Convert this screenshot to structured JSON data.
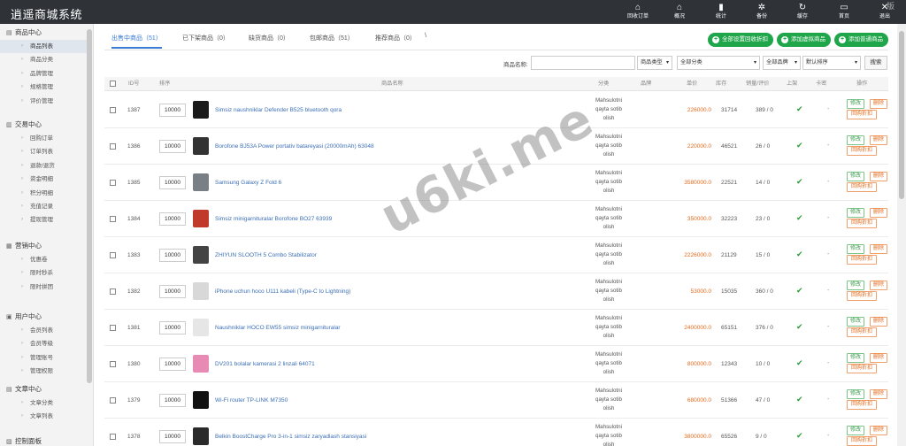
{
  "app": {
    "title": "逍遥商城系统",
    "corner_text": "版"
  },
  "topnav": [
    {
      "icon": "home-icon",
      "glyph": "⌂",
      "label": "回收订单"
    },
    {
      "icon": "home-icon",
      "glyph": "⌂",
      "label": "概况"
    },
    {
      "icon": "bar-chart-icon",
      "glyph": "▮",
      "label": "统计"
    },
    {
      "icon": "gear-icon",
      "glyph": "✲",
      "label": "备份"
    },
    {
      "icon": "refresh-icon",
      "glyph": "↻",
      "label": "缓存"
    },
    {
      "icon": "monitor-icon",
      "glyph": "▭",
      "label": "首页"
    },
    {
      "icon": "close-icon",
      "glyph": "✕",
      "label": "退出"
    }
  ],
  "sidebar": {
    "groups": [
      {
        "title": "商品中心",
        "icon": "box-icon",
        "items": [
          "商品列表",
          "商品分类",
          "品牌管理",
          "规格管理",
          "评价管理"
        ]
      },
      {
        "title": "交易中心",
        "icon": "chart-icon",
        "items": [
          "回购订单",
          "订单列表",
          "退款/退货",
          "资金明细",
          "积分明细",
          "充值记录",
          "提现管理"
        ]
      },
      {
        "title": "营销中心",
        "icon": "folder-icon",
        "items": [
          "优惠卷",
          "限时秒杀",
          "限时拼团"
        ]
      },
      {
        "title": "用户中心",
        "icon": "user-icon",
        "items": [
          "会员列表",
          "会员等级",
          "管理账号",
          "管理权限"
        ]
      },
      {
        "title": "文章中心",
        "icon": "doc-icon",
        "items": [
          "文章分类",
          "文章列表"
        ]
      },
      {
        "title": "控制面板",
        "icon": "settings-icon",
        "items": []
      }
    ],
    "active_item": "商品列表"
  },
  "tabs": [
    {
      "label": "出售中商品（51）",
      "active": true
    },
    {
      "label": "已下架商品（0）",
      "active": false
    },
    {
      "label": "缺货商品（0）",
      "active": false
    },
    {
      "label": "包邮商品（51）",
      "active": false
    },
    {
      "label": "推荐商品（0）",
      "active": false
    }
  ],
  "tab_extra": "\\",
  "actions": [
    "全部设置回收折扣",
    "添加虚拟商品",
    "添加普通商品"
  ],
  "filters": {
    "name_label": "商品名称:",
    "name_value": "",
    "type_select": "商品类型",
    "category_select": "全部分类",
    "brand_select": "全部品牌",
    "sort_select": "默认排序",
    "search_button": "搜索"
  },
  "table": {
    "headers": [
      "ID号",
      "排序",
      "商品名称",
      "分类",
      "品牌",
      "单价",
      "库存",
      "销量/评价",
      "上架",
      "卡密",
      "操作"
    ],
    "row_buttons": {
      "edit": "修改",
      "delete": "删除",
      "discount": "回购折扣"
    },
    "rows": [
      {
        "id": "1387",
        "sort": "10000",
        "name": "Simsiz naushniklar Defender B525 bluetooth qora",
        "category": [
          "Mahsulotni",
          "qayta sotib",
          "olish"
        ],
        "brand": "",
        "price": "226000.0",
        "stock": "31714",
        "sales": "389 / 0",
        "on_shelf": "✔",
        "card": "-",
        "thumb": "#1a1a1a"
      },
      {
        "id": "1386",
        "sort": "10000",
        "name": "Borofone BJ53A Power portativ batareyasi (20000mAh) 63048",
        "category": [
          "Mahsulotni",
          "qayta sotib",
          "olish"
        ],
        "brand": "",
        "price": "220000.0",
        "stock": "46521",
        "sales": "26 / 0",
        "on_shelf": "✔",
        "card": "-",
        "thumb": "#333"
      },
      {
        "id": "1385",
        "sort": "10000",
        "name": "Samsung Galaxy Z Fold 6",
        "category": [
          "Mahsulotni",
          "qayta sotib",
          "olish"
        ],
        "brand": "",
        "price": "3580000.0",
        "stock": "22521",
        "sales": "14 / 0",
        "on_shelf": "✔",
        "card": "-",
        "thumb": "#7a7f85"
      },
      {
        "id": "1384",
        "sort": "10000",
        "name": "Simsiz minigarnituralar Borofone BO27 63939",
        "category": [
          "Mahsulotni",
          "qayta sotib",
          "olish"
        ],
        "brand": "",
        "price": "350000.0",
        "stock": "32223",
        "sales": "23 / 0",
        "on_shelf": "✔",
        "card": "-",
        "thumb": "#c0392b"
      },
      {
        "id": "1383",
        "sort": "10000",
        "name": "ZHIYUN SLOOTH 5 Combo Stabilizator",
        "category": [
          "Mahsulotni",
          "qayta sotib",
          "olish"
        ],
        "brand": "",
        "price": "2226000.0",
        "stock": "21129",
        "sales": "15 / 0",
        "on_shelf": "✔",
        "card": "-",
        "thumb": "#444"
      },
      {
        "id": "1382",
        "sort": "10000",
        "name": "iPhone uchun hoco U111 kabeli (Type-C to Lightning)",
        "category": [
          "Mahsulotni",
          "qayta sotib",
          "olish"
        ],
        "brand": "",
        "price": "53000.0",
        "stock": "15035",
        "sales": "360 / 0",
        "on_shelf": "✔",
        "card": "-",
        "thumb": "#d8d8d8"
      },
      {
        "id": "1381",
        "sort": "10000",
        "name": "Naushniklar HOCO EW55 simsiz minigarnituralar",
        "category": [
          "Mahsulotni",
          "qayta sotib",
          "olish"
        ],
        "brand": "",
        "price": "2400000.0",
        "stock": "65151",
        "sales": "376 / 0",
        "on_shelf": "✔",
        "card": "-",
        "thumb": "#e6e6e6"
      },
      {
        "id": "1380",
        "sort": "10000",
        "name": "DV201 bolalar kamerasi 2 linzali 64071",
        "category": [
          "Mahsulotni",
          "qayta sotib",
          "olish"
        ],
        "brand": "",
        "price": "800000.0",
        "stock": "12343",
        "sales": "10 / 0",
        "on_shelf": "✔",
        "card": "-",
        "thumb": "#e88bb4"
      },
      {
        "id": "1379",
        "sort": "10000",
        "name": "Wi-Fi router TP-LINK M7350",
        "category": [
          "Mahsulotni",
          "qayta sotib",
          "olish"
        ],
        "brand": "",
        "price": "680000.0",
        "stock": "51366",
        "sales": "47 / 0",
        "on_shelf": "✔",
        "card": "-",
        "thumb": "#111"
      },
      {
        "id": "1378",
        "sort": "10000",
        "name": "Belkin BoostCharge Pro 3-in-1 simsiz zaryadlash stansiyasi",
        "category": [
          "Mahsulotni",
          "qayta sotib",
          "olish"
        ],
        "brand": "",
        "price": "3800000.0",
        "stock": "65526",
        "sales": "9 / 0",
        "on_shelf": "✔",
        "card": "-",
        "thumb": "#2a2a2a"
      }
    ]
  },
  "watermark": "u6ki.me"
}
